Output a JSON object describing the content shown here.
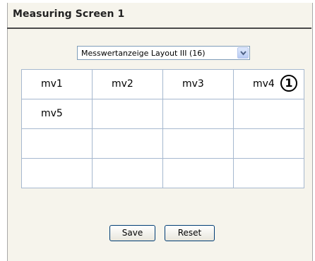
{
  "screen": {
    "title": "Measuring Screen 1"
  },
  "layout_select": {
    "value": "Messwertanzeige Layout III (16)"
  },
  "grid": {
    "rows": [
      [
        "mv1",
        "mv2",
        "mv3",
        "mv4"
      ],
      [
        "mv5",
        "",
        "",
        ""
      ],
      [
        "",
        "",
        "",
        ""
      ],
      [
        "",
        "",
        "",
        ""
      ]
    ],
    "marker": "1"
  },
  "buttons": {
    "save": "Save",
    "reset": "Reset"
  }
}
